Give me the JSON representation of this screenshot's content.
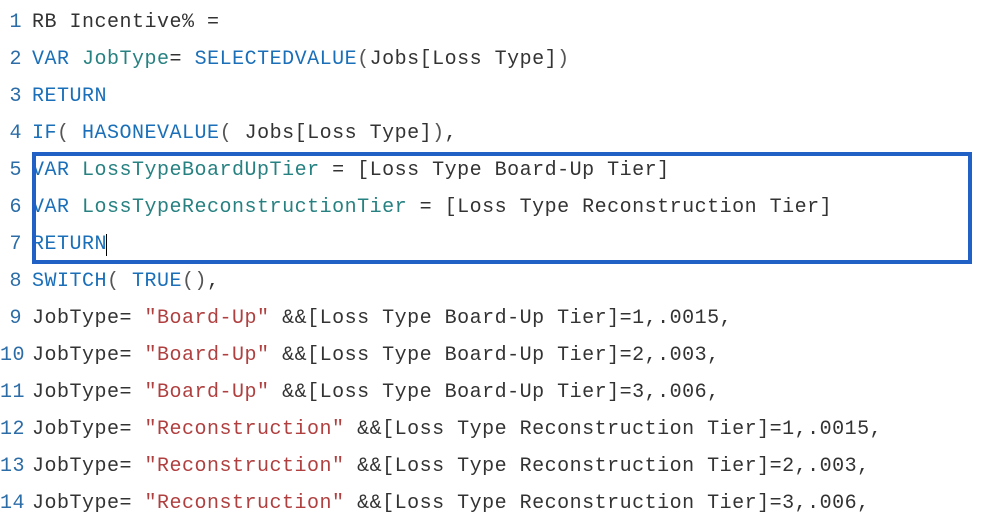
{
  "editor": {
    "lines": [
      {
        "num": "1",
        "tokens": [
          {
            "t": "default",
            "v": "RB Incentive% ="
          }
        ]
      },
      {
        "num": "2",
        "tokens": [
          {
            "t": "keyword",
            "v": "VAR"
          },
          {
            "t": "default",
            "v": " "
          },
          {
            "t": "identifier",
            "v": "JobType"
          },
          {
            "t": "default",
            "v": "= "
          },
          {
            "t": "function",
            "v": "SELECTEDVALUE"
          },
          {
            "t": "paren",
            "v": "("
          },
          {
            "t": "default",
            "v": "Jobs[Loss Type]"
          },
          {
            "t": "paren",
            "v": ")"
          }
        ]
      },
      {
        "num": "3",
        "tokens": [
          {
            "t": "keyword",
            "v": "RETURN"
          }
        ]
      },
      {
        "num": "4",
        "tokens": [
          {
            "t": "function",
            "v": "IF"
          },
          {
            "t": "paren",
            "v": "( "
          },
          {
            "t": "function",
            "v": "HASONEVALUE"
          },
          {
            "t": "paren",
            "v": "( "
          },
          {
            "t": "default",
            "v": "Jobs[Loss Type]"
          },
          {
            "t": "paren",
            "v": ")"
          },
          {
            "t": "default",
            "v": ","
          }
        ]
      },
      {
        "num": "5",
        "tokens": [
          {
            "t": "keyword",
            "v": "VAR"
          },
          {
            "t": "default",
            "v": " "
          },
          {
            "t": "identifier",
            "v": "LossTypeBoardUpTier"
          },
          {
            "t": "default",
            "v": " = [Loss Type Board-Up Tier]"
          }
        ]
      },
      {
        "num": "6",
        "tokens": [
          {
            "t": "keyword",
            "v": "VAR"
          },
          {
            "t": "default",
            "v": " "
          },
          {
            "t": "identifier",
            "v": "LossTypeReconstructionTier"
          },
          {
            "t": "default",
            "v": " = [Loss Type Reconstruction Tier]"
          }
        ]
      },
      {
        "num": "7",
        "tokens": [
          {
            "t": "keyword",
            "v": "RETURN"
          }
        ],
        "cursor": true
      },
      {
        "num": "8",
        "tokens": [
          {
            "t": "function",
            "v": "SWITCH"
          },
          {
            "t": "paren",
            "v": "( "
          },
          {
            "t": "function",
            "v": "TRUE"
          },
          {
            "t": "paren",
            "v": "()"
          },
          {
            "t": "default",
            "v": ","
          }
        ]
      },
      {
        "num": "9",
        "tokens": [
          {
            "t": "default",
            "v": "JobType= "
          },
          {
            "t": "string",
            "v": "\"Board-Up\""
          },
          {
            "t": "default",
            "v": " &&[Loss Type Board-Up Tier]=1,.0015,"
          }
        ]
      },
      {
        "num": "10",
        "tokens": [
          {
            "t": "default",
            "v": "JobType= "
          },
          {
            "t": "string",
            "v": "\"Board-Up\""
          },
          {
            "t": "default",
            "v": " &&[Loss Type Board-Up Tier]=2,.003,"
          }
        ]
      },
      {
        "num": "11",
        "tokens": [
          {
            "t": "default",
            "v": "JobType= "
          },
          {
            "t": "string",
            "v": "\"Board-Up\""
          },
          {
            "t": "default",
            "v": " &&[Loss Type Board-Up Tier]=3,.006,"
          }
        ]
      },
      {
        "num": "12",
        "tokens": [
          {
            "t": "default",
            "v": "JobType= "
          },
          {
            "t": "string",
            "v": "\"Reconstruction\""
          },
          {
            "t": "default",
            "v": " &&[Loss Type Reconstruction Tier]=1,.0015,"
          }
        ]
      },
      {
        "num": "13",
        "tokens": [
          {
            "t": "default",
            "v": "JobType= "
          },
          {
            "t": "string",
            "v": "\"Reconstruction\""
          },
          {
            "t": "default",
            "v": " &&[Loss Type Reconstruction Tier]=2,.003,"
          }
        ]
      },
      {
        "num": "14",
        "tokens": [
          {
            "t": "default",
            "v": "JobType= "
          },
          {
            "t": "string",
            "v": "\"Reconstruction\""
          },
          {
            "t": "default",
            "v": " &&[Loss Type Reconstruction Tier]=3,.006,"
          }
        ]
      }
    ]
  }
}
